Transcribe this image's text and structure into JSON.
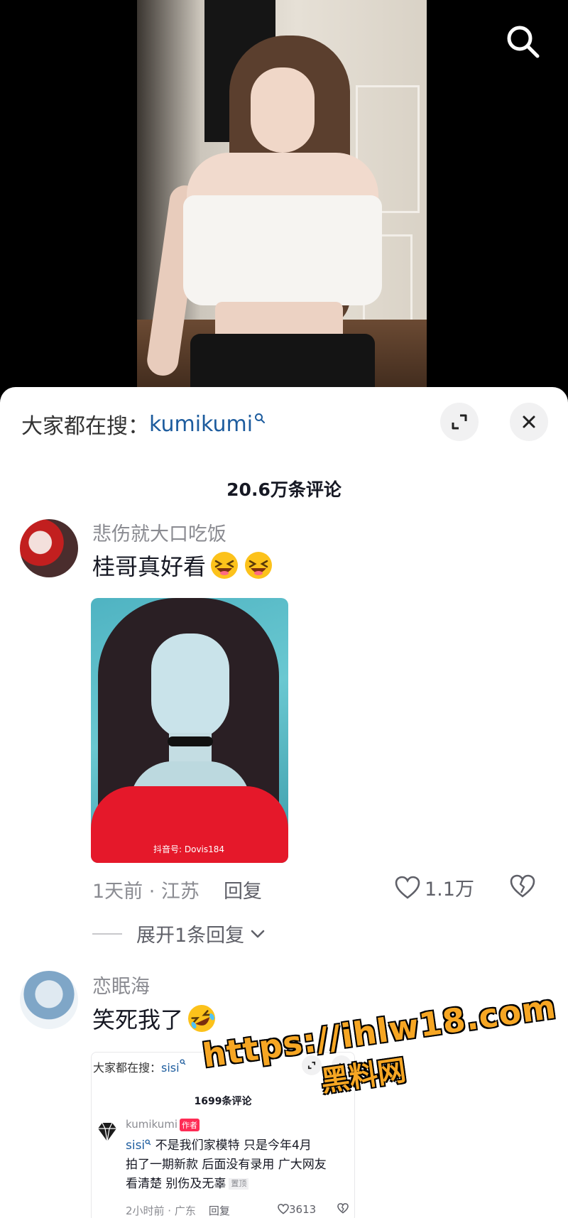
{
  "header": {
    "search_icon": "search-icon"
  },
  "sheet": {
    "search_hint_label": "大家都在搜：",
    "search_keyword": "kumikumi",
    "expand_icon": "expand-icon",
    "close_icon": "close-icon",
    "comment_count": "20.6万条评论"
  },
  "comments": [
    {
      "username": "悲伤就大口吃饭",
      "text": "桂哥真好看",
      "emoji": [
        "laughing-face-emoji",
        "laughing-face-emoji"
      ],
      "image_watermark": "抖音号: Dovis184",
      "time_location": "1天前 · 江苏",
      "reply_label": "回复",
      "likes": "1.1万",
      "expand_replies_label": "展开1条回复"
    },
    {
      "username": "恋眠海",
      "text": "笑死我了",
      "emoji": [
        "rolling-on-floor-laughing-emoji"
      ],
      "embedded_screenshot": {
        "search_hint_label": "大家都在搜：",
        "search_keyword": "sisi",
        "comment_count": "1699条评论",
        "username": "kumikumi",
        "author_tag": "作者",
        "text_keyword": "sisi",
        "text_line1": "不是我们家模特 只是今年4月",
        "text_line2": "拍了一期新款 后面没有录用 广大网友",
        "text_line3": "看清楚 别伤及无辜",
        "pinned_tag": "置顶",
        "time_location": "2小时前 · 广东",
        "reply_label": "回复",
        "likes": "3613"
      }
    }
  ],
  "watermark": {
    "line1": "https://ihlw18.com",
    "line2": "黑料网"
  },
  "colors": {
    "keyword_blue": "#1d5c9e",
    "watermark_orange": "#f6a623",
    "author_tag_red": "#fe2c55"
  }
}
